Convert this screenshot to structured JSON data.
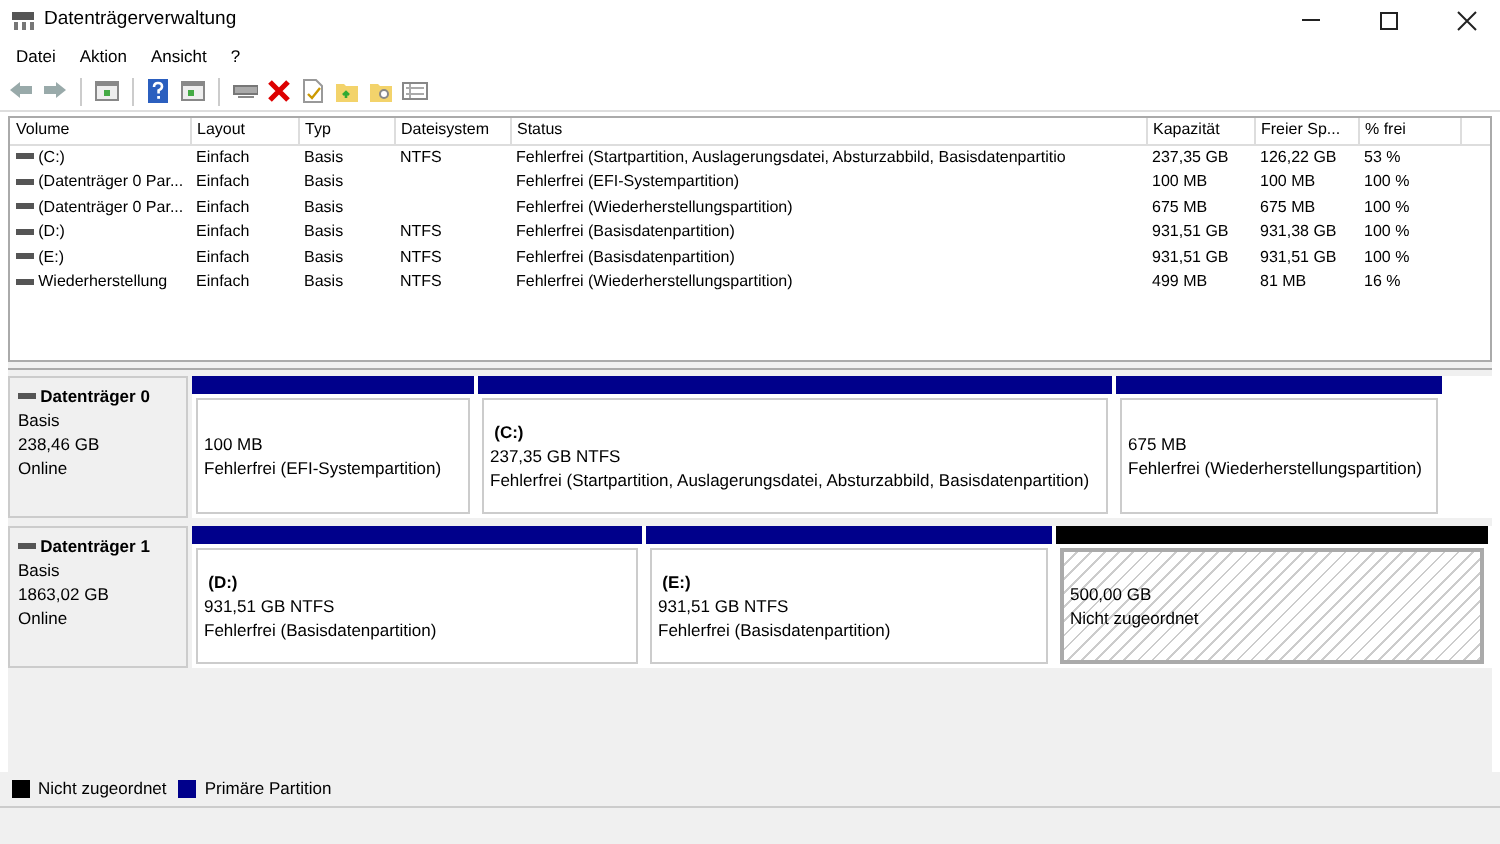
{
  "window": {
    "title": "Datenträgerverwaltung"
  },
  "menu": [
    "Datei",
    "Aktion",
    "Ansicht",
    "?"
  ],
  "table": {
    "columns": [
      "Volume",
      "Layout",
      "Typ",
      "Dateisystem",
      "Status",
      "Kapazität",
      "Freier Sp...",
      "% frei"
    ],
    "rows": [
      {
        "cells": [
          "(C:)",
          "Einfach",
          "Basis",
          "NTFS",
          "Fehlerfrei (Startpartition, Auslagerungsdatei, Absturzabbild, Basisdatenpartitio",
          "237,35 GB",
          "126,22 GB",
          "53 %"
        ]
      },
      {
        "cells": [
          "(Datenträger 0 Par...",
          "Einfach",
          "Basis",
          "",
          "Fehlerfrei (EFI-Systempartition)",
          "100 MB",
          "100 MB",
          "100 %"
        ]
      },
      {
        "cells": [
          "(Datenträger 0 Par...",
          "Einfach",
          "Basis",
          "",
          "Fehlerfrei (Wiederherstellungspartition)",
          "675 MB",
          "675 MB",
          "100 %"
        ]
      },
      {
        "cells": [
          "(D:)",
          "Einfach",
          "Basis",
          "NTFS",
          "Fehlerfrei (Basisdatenpartition)",
          "931,51 GB",
          "931,38 GB",
          "100 %"
        ]
      },
      {
        "cells": [
          "(E:)",
          "Einfach",
          "Basis",
          "NTFS",
          "Fehlerfrei (Basisdatenpartition)",
          "931,51 GB",
          "931,51 GB",
          "100 %"
        ]
      },
      {
        "cells": [
          "Wiederherstellung",
          "Einfach",
          "Basis",
          "NTFS",
          "Fehlerfrei (Wiederherstellungspartition)",
          "499 MB",
          "81 MB",
          "16 %"
        ]
      }
    ]
  },
  "disks": [
    {
      "name": "Datenträger 0",
      "type": "Basis",
      "size": "238,46 GB",
      "state": "Online",
      "partitions": [
        {
          "kind": "primary",
          "size": "100 MB",
          "status": "Fehlerfrei (EFI-Systempartition)"
        },
        {
          "kind": "primary",
          "label": "(C:)",
          "size": "237,35 GB NTFS",
          "status": "Fehlerfrei (Startpartition, Auslagerungsdatei, Absturzabbild, Basisdatenpartition)"
        },
        {
          "kind": "primary",
          "size": "675 MB",
          "status": "Fehlerfrei (Wiederherstellungspartition)"
        }
      ]
    },
    {
      "name": "Datenträger 1",
      "type": "Basis",
      "size": "1863,02 GB",
      "state": "Online",
      "partitions": [
        {
          "kind": "primary",
          "label": "(D:)",
          "size": "931,51 GB NTFS",
          "status": "Fehlerfrei (Basisdatenpartition)"
        },
        {
          "kind": "primary",
          "label": "(E:)",
          "size": "931,51 GB NTFS",
          "status": "Fehlerfrei (Basisdatenpartition)"
        },
        {
          "kind": "unallocated",
          "size": "500,00 GB",
          "status": "Nicht zugeordnet"
        }
      ]
    }
  ],
  "legend": [
    {
      "kind": "unallocated",
      "label": "Nicht zugeordnet",
      "color": "#000000"
    },
    {
      "kind": "primary",
      "label": "Primäre Partition",
      "color": "#00008b"
    }
  ]
}
